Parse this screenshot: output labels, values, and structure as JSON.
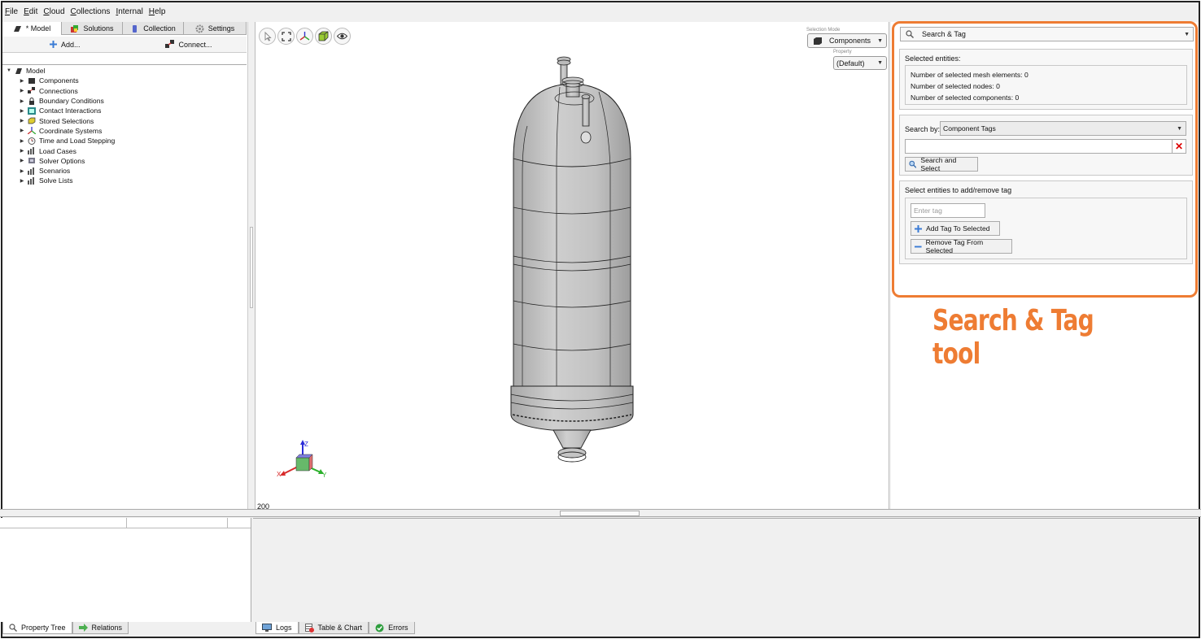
{
  "menu": [
    "File",
    "Edit",
    "Cloud",
    "Collections",
    "Internal",
    "Help"
  ],
  "left_tabs": [
    {
      "label": "* Model",
      "icon": "model-cube-icon"
    },
    {
      "label": "Solutions",
      "icon": "solutions-icon"
    },
    {
      "label": "Collection",
      "icon": "collection-icon"
    },
    {
      "label": "Settings",
      "icon": "gear-icon"
    }
  ],
  "toolbar": {
    "add_label": "Add...",
    "connect_label": "Connect..."
  },
  "tree": {
    "root": "Model",
    "items": [
      {
        "label": "Components",
        "icon": "component-cube-icon"
      },
      {
        "label": "Connections",
        "icon": "connection-icon"
      },
      {
        "label": "Boundary Conditions",
        "icon": "lock-icon"
      },
      {
        "label": "Contact Interactions",
        "icon": "contact-icon"
      },
      {
        "label": "Stored Selections",
        "icon": "selection-cube-icon"
      },
      {
        "label": "Coordinate Systems",
        "icon": "axes-icon"
      },
      {
        "label": "Time and Load Stepping",
        "icon": "clock-icon"
      },
      {
        "label": "Load Cases",
        "icon": "chart-icon"
      },
      {
        "label": "Solver Options",
        "icon": "solver-icon"
      },
      {
        "label": "Scenarios",
        "icon": "chart-icon"
      },
      {
        "label": "Solve Lists",
        "icon": "chart-icon"
      }
    ]
  },
  "viewport": {
    "selection_mode_label": "Selection Mode",
    "selection_mode_value": "Components",
    "property_label": "Property",
    "property_value": "(Default)",
    "scale_label": "200",
    "triad": {
      "x": "X",
      "y": "Y",
      "z": "Z"
    }
  },
  "search_tag": {
    "title": "Search & Tag",
    "selected_header": "Selected entities:",
    "mesh_elements": "Number of selected mesh elements: 0",
    "nodes": "Number of selected nodes: 0",
    "components": "Number of selected components: 0",
    "search_by_label": "Search by:",
    "search_by_value": "Component Tags",
    "search_input_value": "",
    "search_button": "Search and Select",
    "tag_header": "Select entities to add/remove tag",
    "tag_placeholder": "Enter tag",
    "add_tag_button": "Add Tag To Selected",
    "remove_tag_button": "Remove Tag From Selected"
  },
  "callout": "Search & Tag tool",
  "bottom_tabs_left": [
    "Property Tree",
    "Relations"
  ],
  "bottom_tabs_right": [
    "Logs",
    "Table & Chart",
    "Errors"
  ],
  "colors": {
    "accent": "#ee7c33",
    "vessel": "#c4c4c4"
  }
}
